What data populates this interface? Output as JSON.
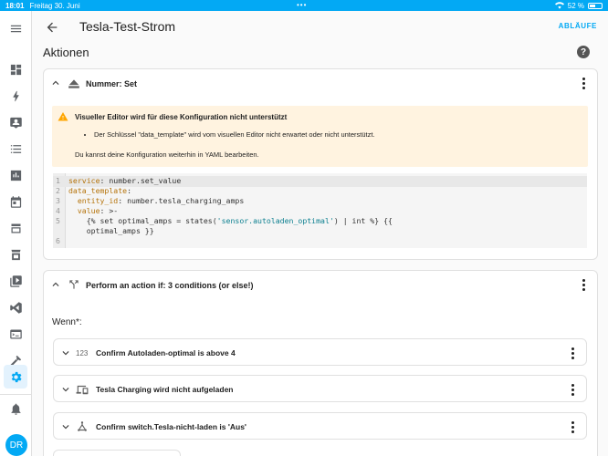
{
  "statusbar": {
    "time": "18:01",
    "date": "Freitag 30. Juni",
    "battery_text": "52 %",
    "battery_level": 0.52
  },
  "sidebar": {
    "items": [
      {
        "name": "menu-icon"
      },
      {
        "name": "dashboard-icon"
      },
      {
        "name": "energy-icon"
      },
      {
        "name": "map-icon"
      },
      {
        "name": "logbook-icon"
      },
      {
        "name": "history-icon"
      },
      {
        "name": "calendar-icon"
      },
      {
        "name": "media-icon"
      },
      {
        "name": "hacs-icon"
      },
      {
        "name": "video-icon"
      },
      {
        "name": "vscode-icon"
      },
      {
        "name": "terminal-icon"
      },
      {
        "name": "hammer-icon"
      },
      {
        "name": "settings-icon",
        "active": true
      },
      {
        "name": "notifications-icon"
      }
    ],
    "avatar": "DR"
  },
  "header": {
    "title": "Tesla-Test-Strom",
    "action": "ABLÄUFE"
  },
  "section": {
    "title": "Aktionen"
  },
  "action_card": {
    "title": "Nummer: Set",
    "warning": {
      "title": "Visueller Editor wird für diese Konfiguration nicht unterstützt",
      "bullet": "Der Schlüssel \"data_template\" wird vom visuellen Editor nicht erwartet oder nicht unterstützt.",
      "subtext": "Du kannst deine Konfiguration weiterhin in YAML bearbeiten."
    },
    "code_lines": [
      {
        "n": "1",
        "parts": [
          [
            "k",
            "service"
          ],
          [
            "p",
            ": number.set_value"
          ]
        ]
      },
      {
        "n": "2",
        "parts": [
          [
            "k",
            "data_template"
          ],
          [
            "p",
            ":"
          ]
        ]
      },
      {
        "n": "3",
        "parts": [
          [
            "p",
            "  "
          ],
          [
            "k",
            "entity_id"
          ],
          [
            "p",
            ": number.tesla_charging_amps"
          ]
        ]
      },
      {
        "n": "4",
        "parts": [
          [
            "p",
            "  "
          ],
          [
            "k",
            "value"
          ],
          [
            "p",
            ": >-"
          ]
        ]
      },
      {
        "n": "5",
        "parts": [
          [
            "p",
            "    {% set optimal_amps = states("
          ],
          [
            "s",
            "'sensor.autoladen_optimal'"
          ],
          [
            "p",
            ") | int %} {{"
          ]
        ]
      },
      {
        "n": "",
        "parts": [
          [
            "p",
            "    optimal_amps }}"
          ]
        ]
      },
      {
        "n": "6",
        "parts": [
          [
            "p",
            ""
          ]
        ]
      }
    ]
  },
  "condition_card": {
    "title": "Perform an action if: 3 conditions (or else!)",
    "wenn_label": "Wenn*:",
    "conditions": [
      {
        "icon": "123",
        "icon_name": "numeric-icon",
        "label": "Confirm Autoladen-optimal is above 4"
      },
      {
        "icon": "",
        "icon_name": "devices-icon",
        "label": "Tesla Charging wird nicht aufgeladen"
      },
      {
        "icon": "",
        "icon_name": "state-icon",
        "label": "Confirm switch.Tesla-nicht-laden is 'Aus'"
      }
    ]
  },
  "colors": {
    "accent": "#03a9f4",
    "warning_bg": "#fff3e0",
    "warning_icon": "#ffa600"
  }
}
